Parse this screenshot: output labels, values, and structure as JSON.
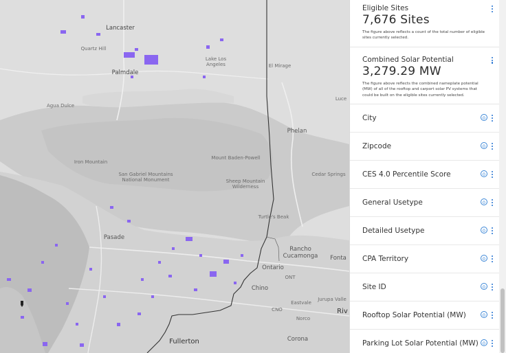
{
  "map": {
    "labels": {
      "lancaster": "Lancaster",
      "quartz_hill": "Quartz Hill",
      "palmdale": "Palmdale",
      "lake_los_angeles": "Lake Los\nAngeles",
      "el_mirage": "El Mirage",
      "agua_dulce": "Agua Dulce",
      "phelan": "Phelan",
      "iron_mountain": "Iron Mountain",
      "mount_baden_powell": "Mount Baden-Powell",
      "san_gabriel": "San Gabriel Mountains\nNational Monument",
      "sheep_mountain": "Sheep Mountain\nWilderness",
      "cedar_springs": "Cedar Springs",
      "turtles_beak": "Turtle's Beak",
      "pasadena": "Pasade",
      "rancho_cucamonga": "Rancho\nCucamonga",
      "fontana": "Fonta",
      "ontario": "Ontario",
      "ont": "ONT",
      "chino": "Chino",
      "eastvale": "Eastvale",
      "jurupa_valley": "Jurupa Valle",
      "cno": "CNO",
      "riverside": "Riv",
      "norco": "Norco",
      "fullerton": "Fullerton",
      "corona": "Corona",
      "lucerne": "Luce"
    },
    "colors": {
      "sites": "#8a66f0",
      "boundary": "#333333",
      "urban": "#cfcfcf",
      "mountains": "#c8c8c8",
      "desert": "#dcdcdc",
      "ocean": "#c9c9c9"
    }
  },
  "panel": {
    "eligible_sites": {
      "title": "Eligible Sites",
      "value": "7,676 Sites",
      "note": "The figure above reflects a count of the total number of eligible sites currently selected."
    },
    "solar_potential": {
      "title": "Combined Solar Potential",
      "value": "3,279.29 MW",
      "note": "The figure above reflects the combined nameplate potential (MW) of all of the rooftop and carport solar PV systems that could be built on the eligible sites currently selected."
    },
    "filters": [
      {
        "label": "City",
        "count": "0"
      },
      {
        "label": "Zipcode",
        "count": "0"
      },
      {
        "label": "CES 4.0 Percentile Score",
        "count": "0"
      },
      {
        "label": "General Usetype",
        "count": "0"
      },
      {
        "label": "Detailed Usetype",
        "count": "0"
      },
      {
        "label": "CPA Territory",
        "count": "0"
      },
      {
        "label": "Site ID",
        "count": "0"
      },
      {
        "label": "Rooftop Solar Potential (MW)",
        "count": "0"
      },
      {
        "label": "Parking Lot Solar Potential (MW)",
        "count": "0"
      }
    ],
    "colors": {
      "accent": "#3b86d6",
      "kebab": "#1f6fd1"
    }
  }
}
